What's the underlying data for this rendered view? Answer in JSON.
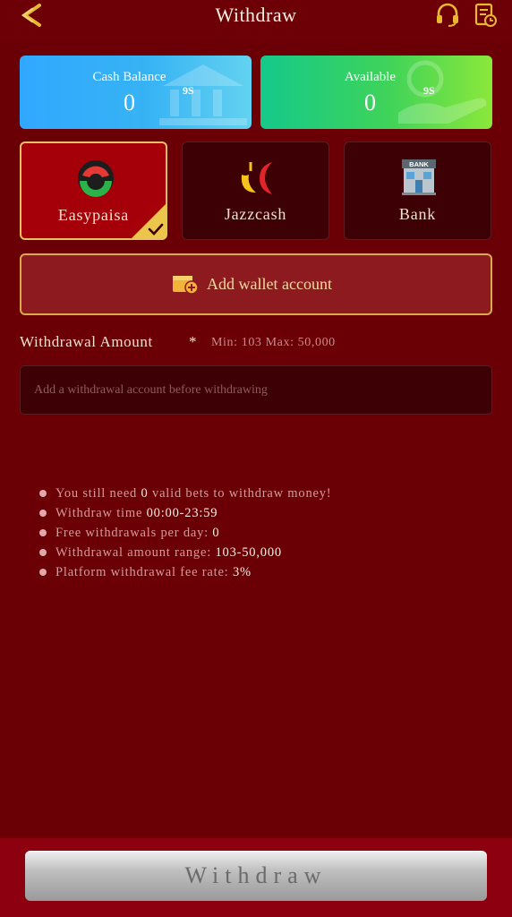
{
  "header": {
    "title": "Withdraw"
  },
  "balances": {
    "cash": {
      "label": "Cash Balance",
      "value": "0",
      "sub": "9S"
    },
    "available": {
      "label": "Available",
      "value": "0",
      "sub": "9S"
    }
  },
  "methods": [
    {
      "label": "Easypaisa",
      "selected": true
    },
    {
      "label": "Jazzcash",
      "selected": false
    },
    {
      "label": "Bank",
      "selected": false,
      "icon_text": "BANK"
    }
  ],
  "add_wallet": {
    "label": "Add wallet account"
  },
  "amount": {
    "label": "Withdrawal Amount",
    "required_mark": "*",
    "limits": "Min: 103 Max: 50,000",
    "placeholder": "Add a withdrawal account before withdrawing",
    "value": ""
  },
  "rules": [
    {
      "prefix": "You still need ",
      "highlight": "0",
      "suffix": " valid bets to withdraw money!"
    },
    {
      "prefix": "Withdraw time ",
      "highlight": "00:00-23:59",
      "suffix": ""
    },
    {
      "prefix": "Free withdrawals per day: ",
      "highlight": "0",
      "suffix": ""
    },
    {
      "prefix": "Withdrawal amount range: ",
      "highlight": "103-50,000",
      "suffix": ""
    },
    {
      "prefix": "Platform withdrawal fee rate: ",
      "highlight": "3%",
      "suffix": ""
    }
  ],
  "footer": {
    "withdraw_label": "Withdraw"
  },
  "colors": {
    "background": "#6a0005",
    "selected_method": "#a5000a",
    "accent_gold": "#e6c162"
  }
}
